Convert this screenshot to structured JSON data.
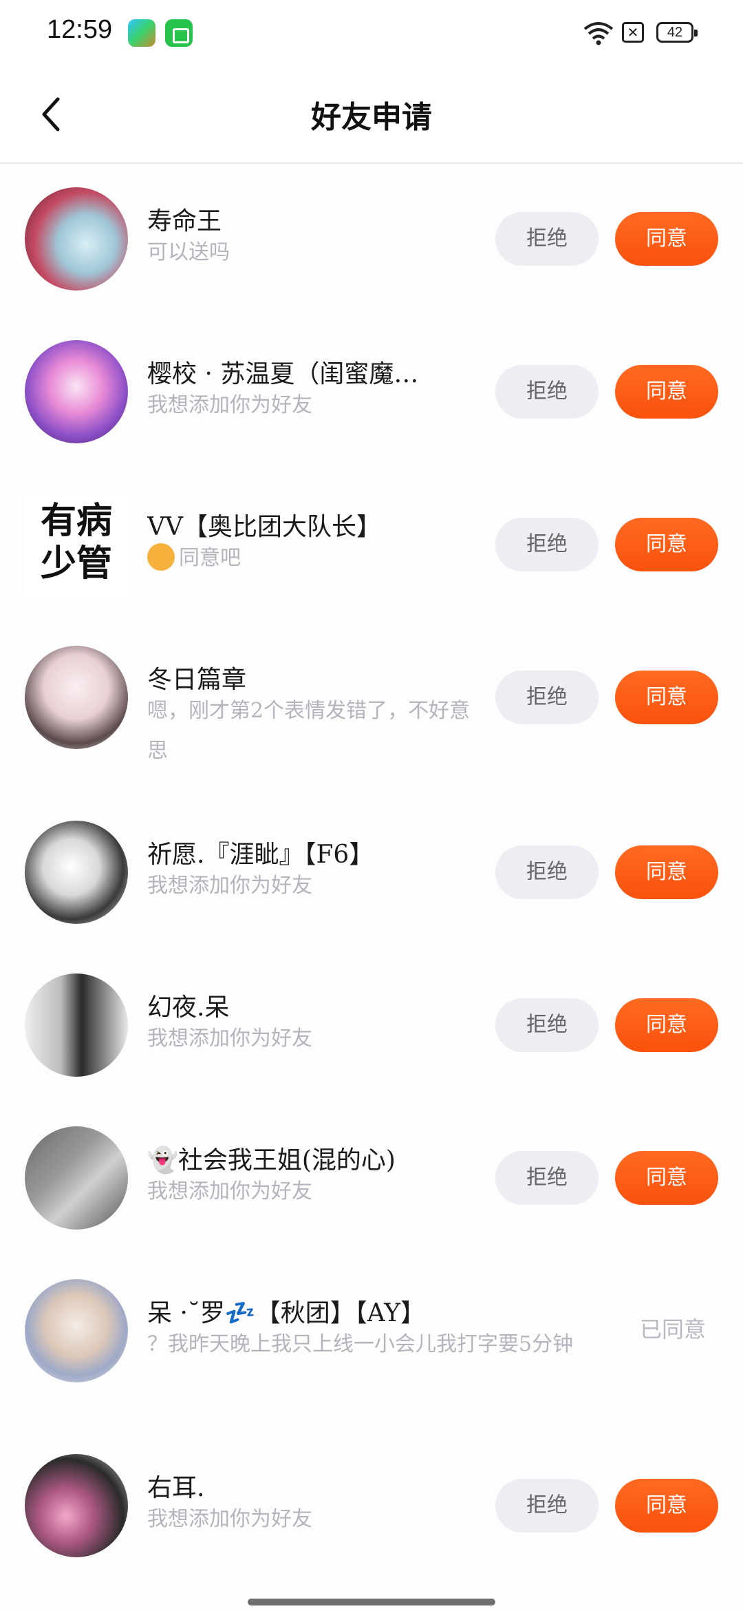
{
  "status_bar": {
    "time": "12:59",
    "battery": "42",
    "sim_icon_text": "✕"
  },
  "header": {
    "title": "好友申请",
    "back_icon": "chevron-left-icon"
  },
  "buttons": {
    "reject_label": "拒绝",
    "accept_label": "同意",
    "accepted_label": "已同意"
  },
  "requests": [
    {
      "name": "寿命王",
      "message": "可以送吗",
      "status": "pending"
    },
    {
      "name": "樱校 · 苏温夏（闺蜜魔…",
      "message": "我想添加你为好友",
      "status": "pending"
    },
    {
      "name": "VV【奥比团大队长】",
      "message": "同意吧",
      "status": "pending",
      "avatar_text": "有病\n少管"
    },
    {
      "name": "冬日篇章",
      "message": "嗯，刚才第2个表情发错了，不好意思",
      "status": "pending"
    },
    {
      "name": "祈愿.『涯眦』【F6】",
      "message": "我想添加你为好友",
      "status": "pending"
    },
    {
      "name": "幻夜.呆",
      "message": "我想添加你为好友",
      "status": "pending"
    },
    {
      "name": "👻社会我王姐(混的心)",
      "message": "我想添加你为好友",
      "status": "pending"
    },
    {
      "name": "呆 ·˘罗💤【秋团】【AY】",
      "message": "？我昨天晚上我只上线一小会儿我打字要5分钟",
      "status": "accepted"
    },
    {
      "name": "右耳.",
      "message": "我想添加你为好友",
      "status": "pending"
    }
  ]
}
